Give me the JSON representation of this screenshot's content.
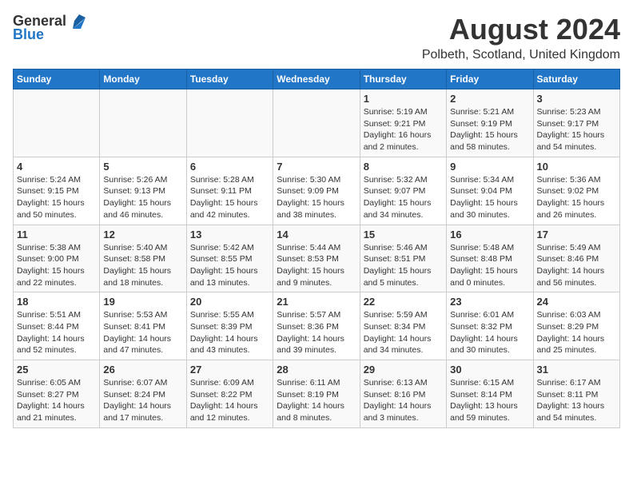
{
  "header": {
    "logo_general": "General",
    "logo_blue": "Blue",
    "title": "August 2024",
    "subtitle": "Polbeth, Scotland, United Kingdom"
  },
  "days_of_week": [
    "Sunday",
    "Monday",
    "Tuesday",
    "Wednesday",
    "Thursday",
    "Friday",
    "Saturday"
  ],
  "weeks": [
    {
      "days": [
        {
          "num": "",
          "detail": ""
        },
        {
          "num": "",
          "detail": ""
        },
        {
          "num": "",
          "detail": ""
        },
        {
          "num": "",
          "detail": ""
        },
        {
          "num": "1",
          "detail": "Sunrise: 5:19 AM\nSunset: 9:21 PM\nDaylight: 16 hours\nand 2 minutes."
        },
        {
          "num": "2",
          "detail": "Sunrise: 5:21 AM\nSunset: 9:19 PM\nDaylight: 15 hours\nand 58 minutes."
        },
        {
          "num": "3",
          "detail": "Sunrise: 5:23 AM\nSunset: 9:17 PM\nDaylight: 15 hours\nand 54 minutes."
        }
      ]
    },
    {
      "days": [
        {
          "num": "4",
          "detail": "Sunrise: 5:24 AM\nSunset: 9:15 PM\nDaylight: 15 hours\nand 50 minutes."
        },
        {
          "num": "5",
          "detail": "Sunrise: 5:26 AM\nSunset: 9:13 PM\nDaylight: 15 hours\nand 46 minutes."
        },
        {
          "num": "6",
          "detail": "Sunrise: 5:28 AM\nSunset: 9:11 PM\nDaylight: 15 hours\nand 42 minutes."
        },
        {
          "num": "7",
          "detail": "Sunrise: 5:30 AM\nSunset: 9:09 PM\nDaylight: 15 hours\nand 38 minutes."
        },
        {
          "num": "8",
          "detail": "Sunrise: 5:32 AM\nSunset: 9:07 PM\nDaylight: 15 hours\nand 34 minutes."
        },
        {
          "num": "9",
          "detail": "Sunrise: 5:34 AM\nSunset: 9:04 PM\nDaylight: 15 hours\nand 30 minutes."
        },
        {
          "num": "10",
          "detail": "Sunrise: 5:36 AM\nSunset: 9:02 PM\nDaylight: 15 hours\nand 26 minutes."
        }
      ]
    },
    {
      "days": [
        {
          "num": "11",
          "detail": "Sunrise: 5:38 AM\nSunset: 9:00 PM\nDaylight: 15 hours\nand 22 minutes."
        },
        {
          "num": "12",
          "detail": "Sunrise: 5:40 AM\nSunset: 8:58 PM\nDaylight: 15 hours\nand 18 minutes."
        },
        {
          "num": "13",
          "detail": "Sunrise: 5:42 AM\nSunset: 8:55 PM\nDaylight: 15 hours\nand 13 minutes."
        },
        {
          "num": "14",
          "detail": "Sunrise: 5:44 AM\nSunset: 8:53 PM\nDaylight: 15 hours\nand 9 minutes."
        },
        {
          "num": "15",
          "detail": "Sunrise: 5:46 AM\nSunset: 8:51 PM\nDaylight: 15 hours\nand 5 minutes."
        },
        {
          "num": "16",
          "detail": "Sunrise: 5:48 AM\nSunset: 8:48 PM\nDaylight: 15 hours\nand 0 minutes."
        },
        {
          "num": "17",
          "detail": "Sunrise: 5:49 AM\nSunset: 8:46 PM\nDaylight: 14 hours\nand 56 minutes."
        }
      ]
    },
    {
      "days": [
        {
          "num": "18",
          "detail": "Sunrise: 5:51 AM\nSunset: 8:44 PM\nDaylight: 14 hours\nand 52 minutes."
        },
        {
          "num": "19",
          "detail": "Sunrise: 5:53 AM\nSunset: 8:41 PM\nDaylight: 14 hours\nand 47 minutes."
        },
        {
          "num": "20",
          "detail": "Sunrise: 5:55 AM\nSunset: 8:39 PM\nDaylight: 14 hours\nand 43 minutes."
        },
        {
          "num": "21",
          "detail": "Sunrise: 5:57 AM\nSunset: 8:36 PM\nDaylight: 14 hours\nand 39 minutes."
        },
        {
          "num": "22",
          "detail": "Sunrise: 5:59 AM\nSunset: 8:34 PM\nDaylight: 14 hours\nand 34 minutes."
        },
        {
          "num": "23",
          "detail": "Sunrise: 6:01 AM\nSunset: 8:32 PM\nDaylight: 14 hours\nand 30 minutes."
        },
        {
          "num": "24",
          "detail": "Sunrise: 6:03 AM\nSunset: 8:29 PM\nDaylight: 14 hours\nand 25 minutes."
        }
      ]
    },
    {
      "days": [
        {
          "num": "25",
          "detail": "Sunrise: 6:05 AM\nSunset: 8:27 PM\nDaylight: 14 hours\nand 21 minutes."
        },
        {
          "num": "26",
          "detail": "Sunrise: 6:07 AM\nSunset: 8:24 PM\nDaylight: 14 hours\nand 17 minutes."
        },
        {
          "num": "27",
          "detail": "Sunrise: 6:09 AM\nSunset: 8:22 PM\nDaylight: 14 hours\nand 12 minutes."
        },
        {
          "num": "28",
          "detail": "Sunrise: 6:11 AM\nSunset: 8:19 PM\nDaylight: 14 hours\nand 8 minutes."
        },
        {
          "num": "29",
          "detail": "Sunrise: 6:13 AM\nSunset: 8:16 PM\nDaylight: 14 hours\nand 3 minutes."
        },
        {
          "num": "30",
          "detail": "Sunrise: 6:15 AM\nSunset: 8:14 PM\nDaylight: 13 hours\nand 59 minutes."
        },
        {
          "num": "31",
          "detail": "Sunrise: 6:17 AM\nSunset: 8:11 PM\nDaylight: 13 hours\nand 54 minutes."
        }
      ]
    }
  ]
}
